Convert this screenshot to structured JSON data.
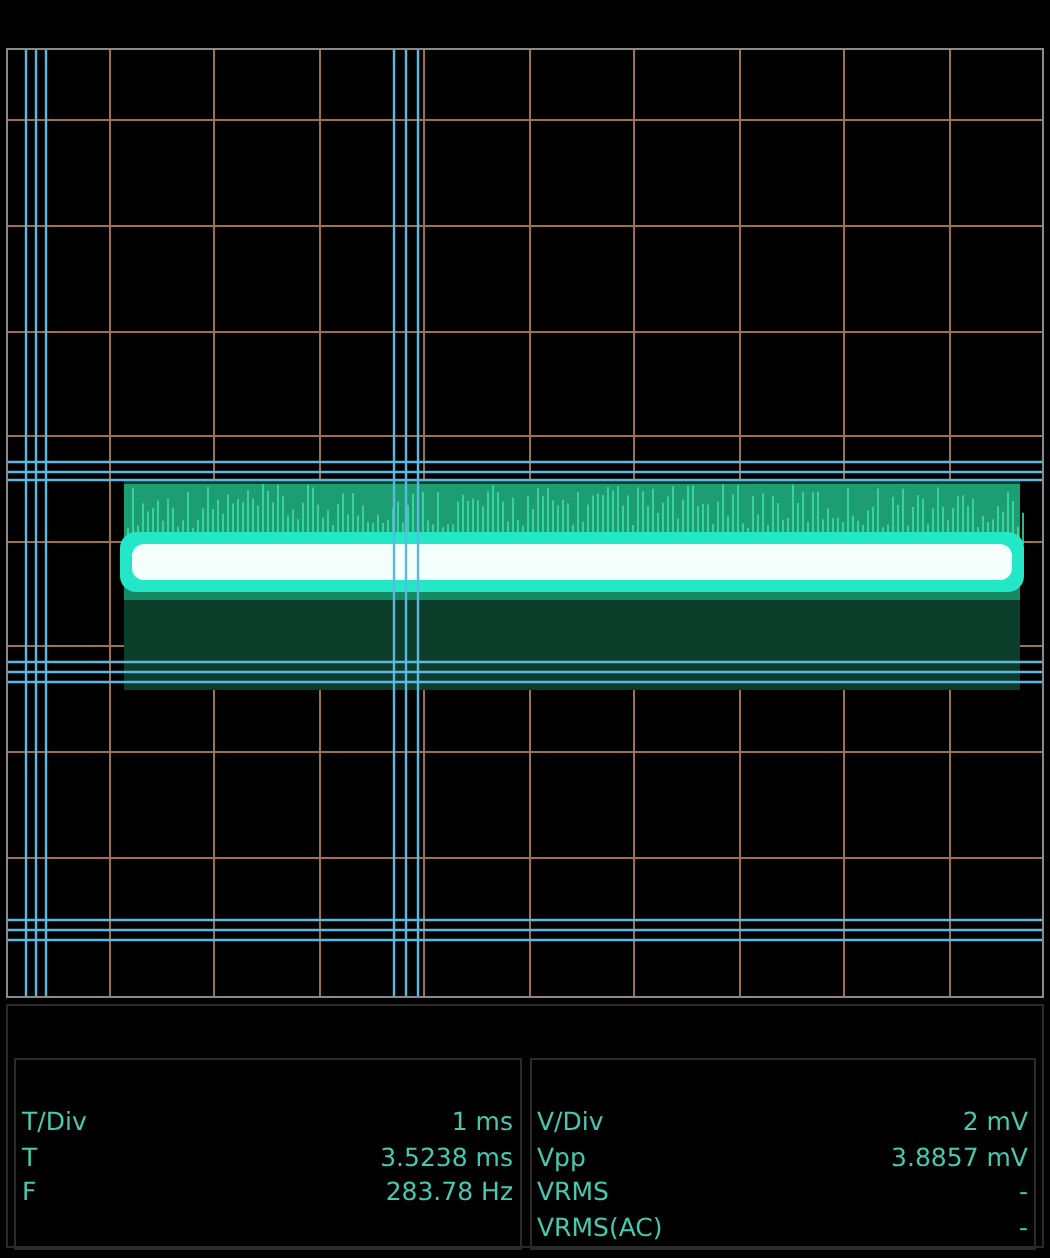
{
  "scope": {
    "kind": "waveform"
  },
  "measurements": [
    {
      "rows": [
        {
          "label": "T/Div",
          "value": "1 ms"
        },
        {
          "label": "T",
          "value": "3.5238 ms"
        },
        {
          "label": "F",
          "value": "283.78 Hz"
        }
      ]
    },
    {
      "rows": [
        {
          "label": "V/Div",
          "value": "2 mV"
        },
        {
          "label": "Vpp",
          "value": "3.8857 mV"
        },
        {
          "label": "VRMS",
          "value": "-"
        },
        {
          "label": "VRMS(AC)",
          "value": "-"
        }
      ]
    }
  ]
}
